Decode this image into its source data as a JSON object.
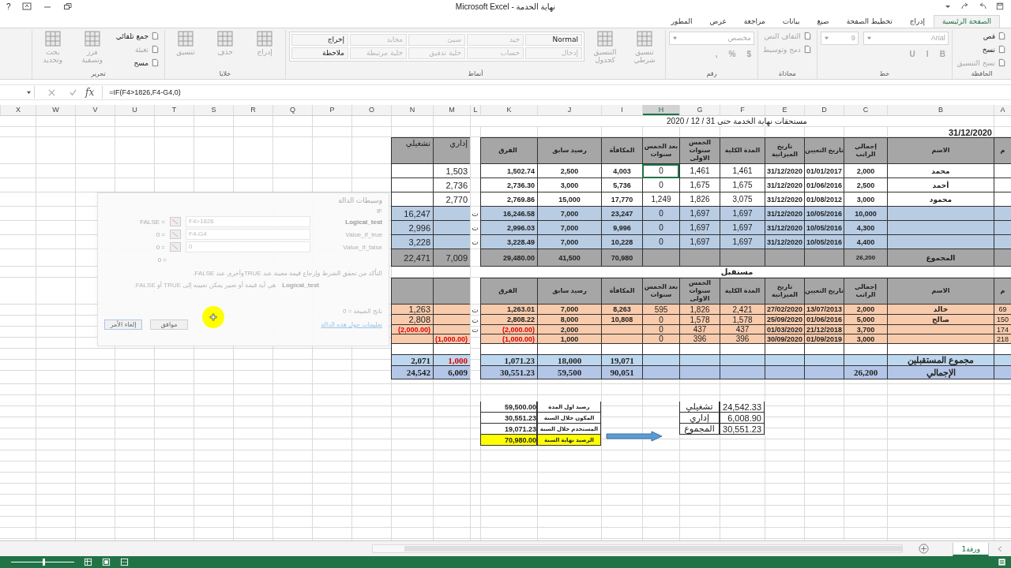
{
  "title_bar": {
    "title": "نهاية الخدمة - Microsoft Excel",
    "help": "?"
  },
  "ribbon_tabs": [
    {
      "label": "الصفحة الرئيسية",
      "selected": true
    },
    {
      "label": "إدراج",
      "selected": false
    },
    {
      "label": "تخطيط الصفحة",
      "selected": false
    },
    {
      "label": "صيغ",
      "selected": false
    },
    {
      "label": "بيانات",
      "selected": false
    },
    {
      "label": "مراجعة",
      "selected": false
    },
    {
      "label": "عرض",
      "selected": false
    },
    {
      "label": "المطور",
      "selected": false
    }
  ],
  "ribbon": {
    "groups": [
      {
        "label": "الحافظة",
        "kind": "stack",
        "items": [
          {
            "kind": "small",
            "label": "قص",
            "disabled": false
          },
          {
            "kind": "small",
            "label": "نسخ",
            "disabled": false
          },
          {
            "kind": "small",
            "label": "نسخ التنسيق",
            "disabled": true
          }
        ]
      },
      {
        "label": "خط",
        "kind": "lines",
        "lines": [
          [
            {
              "kind": "field",
              "label": "Arial",
              "disabled": true
            },
            {
              "kind": "field",
              "label": "9",
              "disabled": true
            }
          ],
          [
            {
              "kind": "button",
              "label": "B",
              "disabled": true
            },
            {
              "kind": "button",
              "label": "I",
              "disabled": true
            },
            {
              "kind": "button",
              "label": "U",
              "disabled": true
            }
          ]
        ]
      },
      {
        "label": "محاذاة",
        "kind": "stack",
        "items": [
          {
            "kind": "small",
            "label": "التفاف النص",
            "disabled": true
          },
          {
            "kind": "small",
            "label": "دمج وتوسيط",
            "disabled": true
          }
        ]
      },
      {
        "label": "رقم",
        "kind": "lines",
        "lines": [
          [
            {
              "kind": "field",
              "label": "مخصص",
              "disabled": true
            }
          ],
          [
            {
              "kind": "button",
              "label": "$",
              "disabled": true
            },
            {
              "kind": "button",
              "label": "%",
              "disabled": true
            },
            {
              "kind": "button",
              "label": ",",
              "disabled": true
            }
          ]
        ]
      },
      {
        "label": "أنماط",
        "kind": "stack",
        "items": [
          {
            "kind": "large",
            "label": "تنسيق شرطي",
            "disabled": true
          },
          {
            "kind": "large",
            "label": "التنسيق كجدول",
            "disabled": true
          }
        ],
        "gallery": [
          {
            "label": "Normal",
            "disabled": false
          },
          {
            "label": "جيد",
            "disabled": true
          },
          {
            "label": "سيئ",
            "disabled": true
          },
          {
            "label": "محايد",
            "disabled": true
          },
          {
            "label": "إخراج",
            "disabled": false
          },
          {
            "label": "إدخال",
            "disabled": true
          },
          {
            "label": "حساب",
            "disabled": true
          },
          {
            "label": "خلية تدقيق",
            "disabled": true
          },
          {
            "label": "خلية مرتبطة",
            "disabled": true
          },
          {
            "label": "ملاحظة",
            "disabled": false
          }
        ]
      },
      {
        "label": "خلايا",
        "kind": "stack",
        "items": [
          {
            "kind": "large",
            "label": "إدراج",
            "disabled": true
          },
          {
            "kind": "large",
            "label": "حذف",
            "disabled": true
          },
          {
            "kind": "large",
            "label": "تنسيق",
            "disabled": true
          }
        ]
      },
      {
        "label": "تحرير",
        "kind": "stack",
        "items": [
          {
            "kind": "small",
            "label": "جمع تلقائي",
            "disabled": false
          },
          {
            "kind": "small",
            "label": "تعبئة",
            "disabled": true
          },
          {
            "kind": "small",
            "label": "مسح",
            "disabled": false
          },
          {
            "kind": "large",
            "label": "فرز وتصفية",
            "disabled": true
          },
          {
            "kind": "large",
            "label": "بحث وتحديد",
            "disabled": true
          }
        ]
      }
    ]
  },
  "formula_bar": {
    "fx": "fx",
    "formula": "=IF(F4>1826,F4-G4,0)"
  },
  "column_headers": [
    {
      "label": "A",
      "selected": false
    },
    {
      "label": "B",
      "selected": false
    },
    {
      "label": "C",
      "selected": false
    },
    {
      "label": "D",
      "selected": false
    },
    {
      "label": "E",
      "selected": false
    },
    {
      "label": "F",
      "selected": false
    },
    {
      "label": "G",
      "selected": false
    },
    {
      "label": "H",
      "selected": true
    },
    {
      "label": "I",
      "selected": false
    },
    {
      "label": "J",
      "selected": false
    },
    {
      "label": "K",
      "selected": false
    },
    {
      "label": "L",
      "selected": false
    },
    {
      "label": "M",
      "selected": false
    },
    {
      "label": "N",
      "selected": false
    },
    {
      "label": "O",
      "selected": false
    },
    {
      "label": "P",
      "selected": false
    },
    {
      "label": "Q",
      "selected": false
    },
    {
      "label": "R",
      "selected": false
    },
    {
      "label": "S",
      "selected": false
    },
    {
      "label": "T",
      "selected": false
    },
    {
      "label": "U",
      "selected": false
    },
    {
      "label": "V",
      "selected": false
    },
    {
      "label": "W",
      "selected": false
    },
    {
      "label": "X",
      "selected": false
    }
  ],
  "sheet": {
    "rows": [
      {
        "kind": "title",
        "text": "مستحقات نهاية الخدمة حتى 31 / 12 / 2020"
      },
      {
        "kind": "date",
        "cells": {
          "b": "31/12/2020"
        }
      },
      {
        "kind": "header",
        "cells": {
          "a": "م",
          "b": "الاسم",
          "c": "إجمالي الراتب",
          "d": "تاريخ التعيين",
          "e": "تاريخ الميزانية",
          "f": "المدة الكلية",
          "g": "الخمس سنوات الاولى",
          "h": "بعد الخمس سنوات",
          "i": "المكافأة",
          "j": "رصيد سابق",
          "k": "الفرق",
          "m": "إداري",
          "n": "تشغيلي"
        }
      },
      {
        "kind": "plain",
        "cells": {
          "b": "محمد",
          "c": "2,000",
          "d": "01/01/2017",
          "e": "31/12/2020",
          "f": "1,461",
          "g": "1,461",
          "h": {
            "text": "0",
            "selected": true
          },
          "i": "4,003",
          "j": "2,500",
          "k": "1,502.74",
          "m": "1,503"
        }
      },
      {
        "kind": "plain",
        "cells": {
          "b": "أحمد",
          "c": "2,500",
          "d": "01/06/2016",
          "e": "31/12/2020",
          "f": "1,675",
          "g": "1,675",
          "h": "0",
          "i": "5,736",
          "j": "3,000",
          "k": "2,736.30",
          "m": "2,736"
        }
      },
      {
        "kind": "plain",
        "cells": {
          "b": "محمود",
          "c": "3,000",
          "d": "01/08/2012",
          "e": "31/12/2020",
          "f": "3,075",
          "g": "1,826",
          "h": "1,249",
          "i": "17,770",
          "j": "15,000",
          "k": "2,769.86",
          "m": "2,770"
        }
      },
      {
        "kind": "blue",
        "cells": {
          "c": "10,000",
          "d": "10/05/2016",
          "e": "31/12/2020",
          "f": "1,697",
          "g": "1,697",
          "h": "0",
          "i": "23,247",
          "j": "7,000",
          "k": "16,246.58",
          "l": "ت",
          "n": "16,247"
        }
      },
      {
        "kind": "blue",
        "cells": {
          "c": "4,300",
          "d": "10/05/2016",
          "e": "31/12/2020",
          "f": "1,697",
          "g": "1,697",
          "h": "0",
          "i": "9,996",
          "j": "7,000",
          "k": "2,996.03",
          "l": "ت",
          "n": "2,996"
        }
      },
      {
        "kind": "blue",
        "cells": {
          "c": "4,400",
          "d": "10/05/2016",
          "e": "31/12/2020",
          "f": "1,697",
          "g": "1,697",
          "h": "0",
          "i": "10,228",
          "j": "7,000",
          "k": "3,228.49",
          "l": "ت",
          "n": "3,228"
        }
      },
      {
        "kind": "total",
        "cells": {
          "b": "المجموع",
          "c": "26,200",
          "i": "70,980",
          "j": "41,500",
          "k": "29,480.00",
          "m": "7,009",
          "n": "22,471"
        }
      },
      {
        "kind": "section",
        "text": "مستقبل"
      },
      {
        "kind": "header",
        "cells": {
          "a": "م",
          "b": "الاسم",
          "c": "إجمالي الراتب",
          "d": "تاريخ التعيين",
          "e": "تاريخ الميزانية",
          "f": "المدة الكلية",
          "g": "الخمس سنوات الاولى",
          "h": "بعد الخمس سنوات",
          "i": "المكافأة",
          "j": "رصيد سابق",
          "k": "الفرق"
        }
      },
      {
        "kind": "orange",
        "cells": {
          "a": "69",
          "b": "خالد",
          "c": "2,000",
          "d": "13/07/2013",
          "e": "27/02/2020",
          "f": "2,421",
          "g": "1,826",
          "h": "595",
          "i": "8,263",
          "j": "7,000",
          "k": "1,263.01",
          "l": "ت",
          "n": "1,263"
        }
      },
      {
        "kind": "orange",
        "cells": {
          "a": "150",
          "b": "صالح",
          "c": "5,000",
          "d": "01/06/2016",
          "e": "25/09/2020",
          "f": "1,578",
          "g": "1,578",
          "h": "0",
          "i": "10,808",
          "j": "8,000",
          "k": "2,808.22",
          "l": "ت",
          "n": "2,808"
        }
      },
      {
        "kind": "orange",
        "cells": {
          "a": "174",
          "c": "3,700",
          "d": "21/12/2018",
          "e": "01/03/2020",
          "f": "437",
          "g": "437",
          "h": "0",
          "j": "2,000",
          "k": {
            "text": "(2,000.00)",
            "kind": "red"
          },
          "l": "ت",
          "n": {
            "text": "(2,000.00)",
            "kind": "red"
          }
        }
      },
      {
        "kind": "orange",
        "cells": {
          "a": "218",
          "c": "3,000",
          "d": "01/09/2019",
          "e": "30/09/2020",
          "f": "396",
          "g": "396",
          "h": "0",
          "j": "1,000",
          "k": {
            "text": "(1,000.00)",
            "kind": "red"
          },
          "m": {
            "text": "(1,000.00)",
            "kind": "red"
          }
        }
      },
      {
        "kind": "blank"
      },
      {
        "kind": "subtotal",
        "cells": {
          "b": "مجموع المستقبلين",
          "i": "19,071",
          "j": "18,000",
          "k": "1,071.23",
          "m": {
            "text": "1,000",
            "kind": "red"
          },
          "n": "2,071"
        }
      },
      {
        "kind": "grand",
        "cells": {
          "b": "الإجمالي",
          "c": "26,200",
          "i": "90,051",
          "j": "59,500",
          "k": "30,551.23",
          "m": "6,009",
          "n": "24,542"
        }
      },
      {
        "kind": "empty"
      },
      {
        "kind": "empty"
      },
      {
        "kind": "summary",
        "cells": {
          "f": {
            "text": "24,542.33",
            "kind": "boxed"
          },
          "g": {
            "text": "تشغيلي",
            "kind": "boxed"
          },
          "j": {
            "text": "رصيد اول المدة",
            "kind": "boxed"
          },
          "k": {
            "text": "59,500.00",
            "kind": "boxed"
          }
        }
      },
      {
        "kind": "summary",
        "cells": {
          "f": {
            "text": "6,008.90",
            "kind": "boxed"
          },
          "g": {
            "text": "إداري",
            "kind": "boxed"
          },
          "j": {
            "text": "المكون خلال السنة",
            "kind": "boxed"
          },
          "k": {
            "text": "30,551.23",
            "kind": "boxed"
          }
        }
      },
      {
        "kind": "summary",
        "cells": {
          "f": {
            "text": "30,551.23",
            "kind": "boxed"
          },
          "g": {
            "text": "المجموع",
            "kind": "boxed"
          },
          "j": {
            "text": "المستخدم خلال السنة",
            "kind": "boxed"
          },
          "k": {
            "text": "19,071.23",
            "kind": "boxed"
          }
        }
      },
      {
        "kind": "summary",
        "cells": {
          "j": {
            "text": "الرصيد نهاية السنة",
            "kind": "yellow"
          },
          "k": {
            "text": "70,980.00",
            "kind": "yellow"
          }
        }
      }
    ]
  },
  "dialog": {
    "title": "وسيطات الدالة",
    "function": "IF",
    "args": [
      {
        "name": "Logical_test",
        "value": "F4>1826",
        "result": "= FALSE"
      },
      {
        "name": "Value_if_true",
        "value": "F4-G4",
        "result": "= 0"
      },
      {
        "name": "Value_if_false",
        "value": "0",
        "result": "= 0"
      }
    ],
    "result": "= 0",
    "description": "التأكد من تحقق الشرط وإرجاع قيمة معينة عند TRUEوأخرى عند FALSE.",
    "arg_help_name": "Logical_test",
    "arg_help": "هي أية قيمة أو تعبير يمكن تعيينه إلى TRUE أو FALSE.",
    "formula_result": "ناتج الصيغة = 0",
    "help_link": "تعليمات حول هذه الدالة",
    "buttons": [
      "موافق",
      "إلغاء الأمر"
    ]
  },
  "sheet_tabs": [
    {
      "label": "ورقة1",
      "selected": true
    }
  ],
  "status_bar": {
    "zoom_slider": {
      "level": 0.5
    }
  }
}
